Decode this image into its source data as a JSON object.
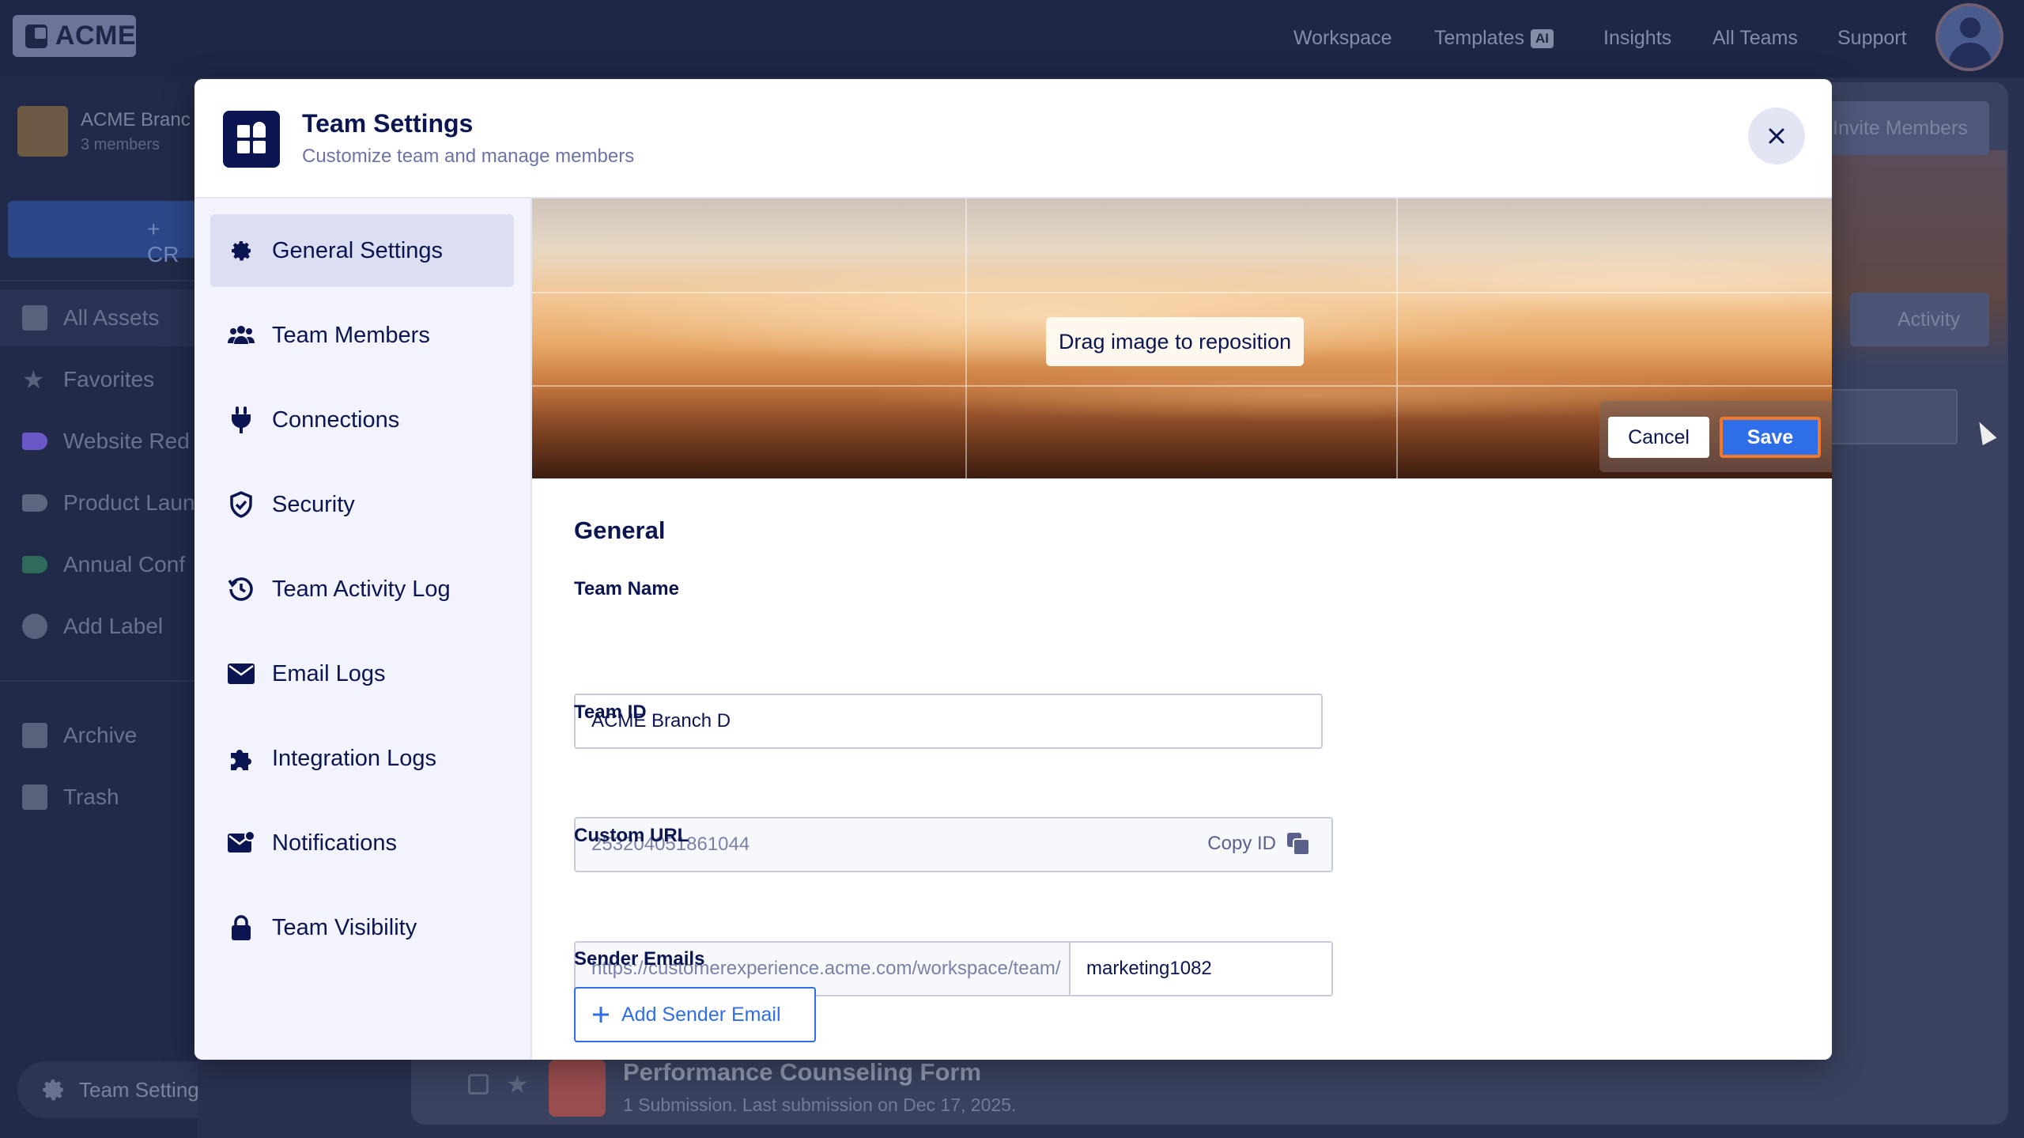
{
  "app": {
    "logo_text": "ACME",
    "nav": {
      "workspace": "Workspace",
      "templates": "Templates",
      "templates_badge": "AI",
      "insights": "Insights",
      "all_teams": "All Teams",
      "support": "Support"
    }
  },
  "sidebar": {
    "team_name": "ACME Branc",
    "team_members": "3 members",
    "create_label": "+ CR",
    "items": [
      {
        "label": "All Assets",
        "icon": "grid-icon"
      },
      {
        "label": "Favorites",
        "icon": "star-icon"
      },
      {
        "label": "Website Red",
        "icon": "label-icon",
        "color": "#6b58c8"
      },
      {
        "label": "Product Laun",
        "icon": "label-icon",
        "color": "#5f667f"
      },
      {
        "label": "Annual Conf",
        "icon": "label-icon",
        "color": "#2f6b5a"
      },
      {
        "label": "Add Label",
        "icon": "plus-circle-icon"
      },
      {
        "label": "Archive",
        "icon": "archive-icon"
      },
      {
        "label": "Trash",
        "icon": "trash-icon"
      }
    ],
    "team_settings_label": "Team Settings"
  },
  "background": {
    "invite_label": "Invite Members",
    "activity_label": "Activity",
    "form_title": "Performance Counseling Form",
    "form_sub": "1 Submission.  Last submission on Dec 17, 2025."
  },
  "modal": {
    "title": "Team Settings",
    "subtitle": "Customize team and manage members",
    "nav": [
      {
        "label": "General Settings",
        "icon": "gear-icon"
      },
      {
        "label": "Team Members",
        "icon": "users-icon"
      },
      {
        "label": "Connections",
        "icon": "plug-icon"
      },
      {
        "label": "Security",
        "icon": "shield-icon"
      },
      {
        "label": "Team Activity Log",
        "icon": "history-icon"
      },
      {
        "label": "Email Logs",
        "icon": "envelope-icon"
      },
      {
        "label": "Integration Logs",
        "icon": "puzzle-icon"
      },
      {
        "label": "Notifications",
        "icon": "mail-bell-icon"
      },
      {
        "label": "Team Visibility",
        "icon": "lock-icon"
      }
    ],
    "cover": {
      "drag_hint": "Drag image to reposition",
      "cancel_label": "Cancel",
      "save_label": "Save"
    },
    "general": {
      "section_title": "General",
      "team_name_label": "Team Name",
      "team_name_value": "ACME Branch D",
      "team_id_label": "Team ID",
      "team_id_value": "253204051861044",
      "copy_id_label": "Copy ID",
      "custom_url_label": "Custom URL",
      "custom_url_prefix": "https://customerexperience.acme.com/workspace/team/",
      "custom_url_slug": "marketing1082",
      "sender_emails_label": "Sender Emails",
      "add_sender_label": "Add Sender Email"
    }
  },
  "colors": {
    "primary": "#2e6ee8",
    "save_focus_ring": "#f2782b",
    "navy": "#0a1551"
  }
}
